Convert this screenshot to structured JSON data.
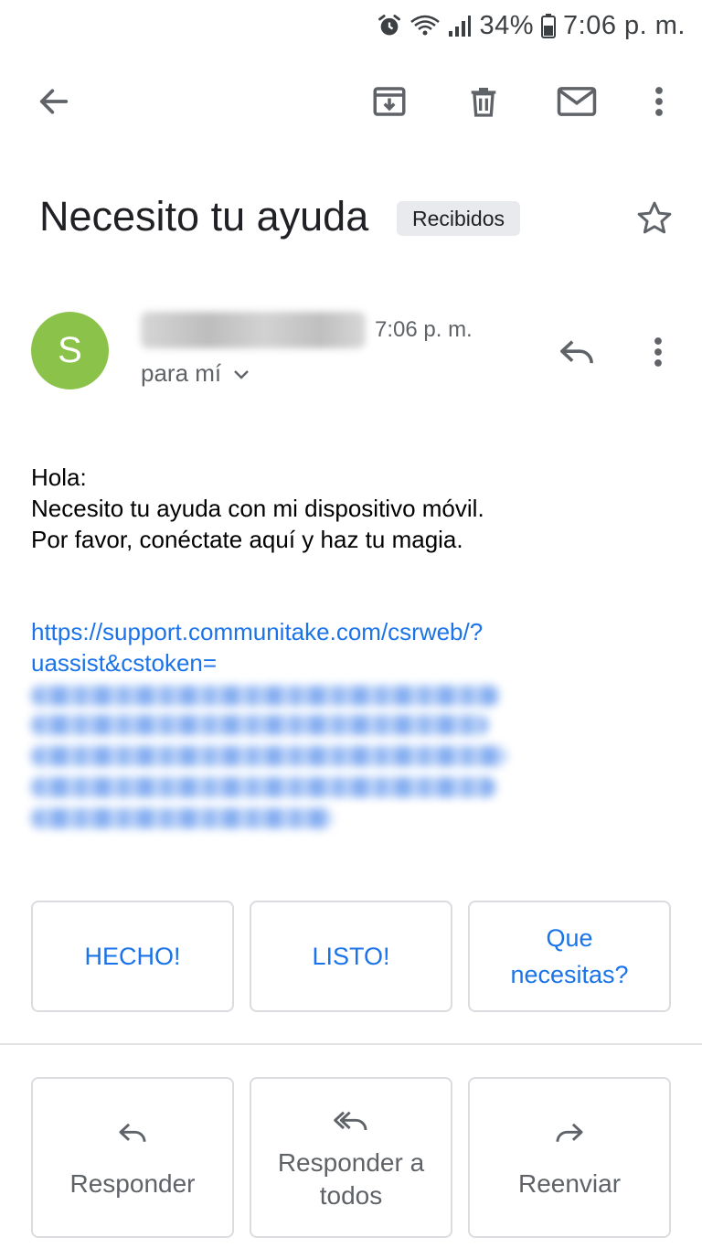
{
  "status_bar": {
    "battery_percent": "34%",
    "time": "7:06 p. m.",
    "icons": [
      "alarm-icon",
      "wifi-icon",
      "signal-icon",
      "battery-icon"
    ]
  },
  "toolbar": {
    "icons": [
      "back-arrow-icon",
      "archive-icon",
      "trash-icon",
      "mark-unread-icon",
      "more-vert-icon"
    ]
  },
  "email": {
    "subject": "Necesito tu ayuda",
    "label": "Recibidos",
    "sender": {
      "avatar_letter": "S",
      "avatar_color": "#8bc34a",
      "time": "7:06 p. m.",
      "recipient": "para mí"
    },
    "body": {
      "lines": [
        "Hola:",
        "Necesito tu ayuda con mi dispositivo móvil.",
        "Por favor, conéctate aquí y haz tu magia."
      ],
      "link_lines": [
        "https://support.communitake.com/csrweb/?",
        "uassist&cstoken="
      ]
    }
  },
  "smart_replies": [
    {
      "label": "HECHO!"
    },
    {
      "label": "LISTO!"
    },
    {
      "label": "Que necesitas?"
    }
  ],
  "actions": [
    {
      "label": "Responder",
      "icon": "reply-icon"
    },
    {
      "label": "Responder a todos",
      "icon": "reply-all-icon"
    },
    {
      "label": "Reenviar",
      "icon": "forward-icon"
    }
  ],
  "colors": {
    "link": "#1a73e8",
    "chip_bg": "#e8eaed",
    "secondary_text": "#5f6368"
  }
}
